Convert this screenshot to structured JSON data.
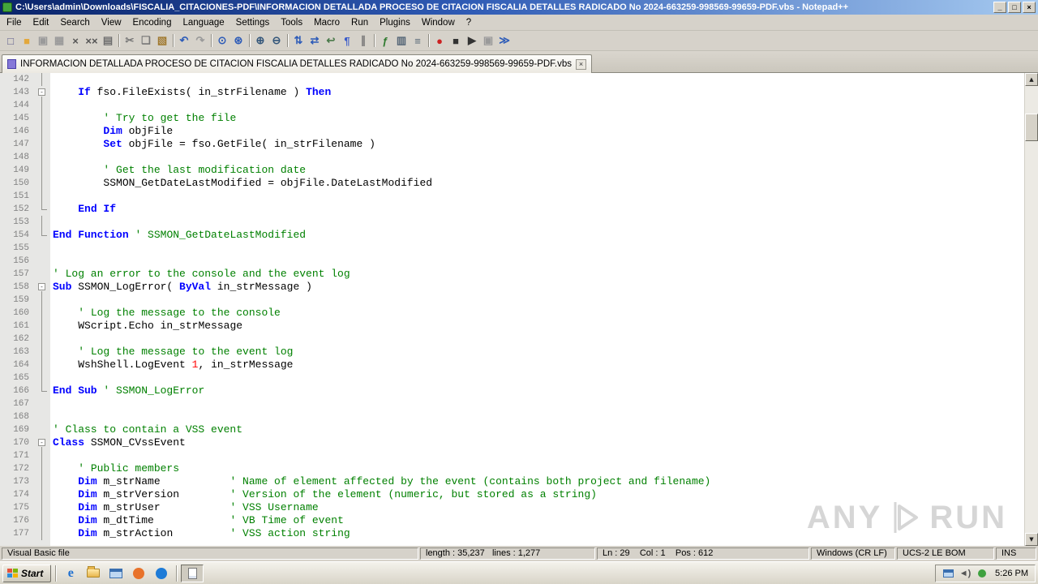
{
  "window": {
    "title": "C:\\Users\\admin\\Downloads\\FISCALIA_CITACIONES-PDF\\INFORMACION DETALLADA PROCESO DE CITACION FISCALIA DETALLES RADICADO No 2024-663259-998569-99659-PDF.vbs - Notepad++",
    "controls": {
      "minimize": "_",
      "maximize": "□",
      "close": "×"
    }
  },
  "colors": {
    "titlebar_left": "#0A246A",
    "titlebar_right": "#A6CAF0",
    "keyword": "#0000FF",
    "comment": "#008000",
    "number": "#FF0000",
    "line_number": "#808080"
  },
  "menu": {
    "items": [
      {
        "label": "File",
        "name": "file"
      },
      {
        "label": "Edit",
        "name": "edit"
      },
      {
        "label": "Search",
        "name": "search"
      },
      {
        "label": "View",
        "name": "view"
      },
      {
        "label": "Encoding",
        "name": "encoding"
      },
      {
        "label": "Language",
        "name": "language"
      },
      {
        "label": "Settings",
        "name": "settings"
      },
      {
        "label": "Tools",
        "name": "tools"
      },
      {
        "label": "Macro",
        "name": "macro"
      },
      {
        "label": "Run",
        "name": "run"
      },
      {
        "label": "Plugins",
        "name": "plugins"
      },
      {
        "label": "Window",
        "name": "window"
      },
      {
        "label": "?",
        "name": "help"
      }
    ]
  },
  "toolbar": {
    "items": [
      {
        "name": "new-file",
        "glyph": "□",
        "color": "#5A5A8C"
      },
      {
        "name": "open-file",
        "glyph": "■",
        "color": "#E3A83C"
      },
      {
        "name": "save-file",
        "glyph": "▣",
        "color": "#9A9A9A"
      },
      {
        "name": "save-all",
        "glyph": "▦",
        "color": "#9A9A9A"
      },
      {
        "name": "close-file",
        "glyph": "×",
        "color": "#555555"
      },
      {
        "name": "close-all",
        "glyph": "××",
        "color": "#555555"
      },
      {
        "name": "print",
        "glyph": "▤",
        "color": "#6E6E6E"
      },
      {
        "sep": true
      },
      {
        "name": "cut",
        "glyph": "✂",
        "color": "#777777"
      },
      {
        "name": "copy",
        "glyph": "❏",
        "color": "#777777"
      },
      {
        "name": "paste",
        "glyph": "▧",
        "color": "#A0792F"
      },
      {
        "sep": true
      },
      {
        "name": "undo",
        "glyph": "↶",
        "color": "#2E5CB8"
      },
      {
        "name": "redo",
        "glyph": "↷",
        "color": "#9A9A9A"
      },
      {
        "sep": true
      },
      {
        "name": "find",
        "glyph": "⊙",
        "color": "#2E5CB8"
      },
      {
        "name": "replace",
        "glyph": "⊛",
        "color": "#2E5CB8"
      },
      {
        "sep": true
      },
      {
        "name": "zoom-in",
        "glyph": "⊕",
        "color": "#33567A"
      },
      {
        "name": "zoom-out",
        "glyph": "⊖",
        "color": "#33567A"
      },
      {
        "sep": true
      },
      {
        "name": "sync-vertical-scroll",
        "glyph": "⇅",
        "color": "#2E5CB8"
      },
      {
        "name": "sync-horizontal-scroll",
        "glyph": "⇄",
        "color": "#2E5CB8"
      },
      {
        "name": "word-wrap",
        "glyph": "↩",
        "color": "#4A7A4A"
      },
      {
        "name": "show-all-characters",
        "glyph": "¶",
        "color": "#3A5ACA"
      },
      {
        "name": "indent-guide",
        "glyph": "∥",
        "color": "#777777"
      },
      {
        "sep": true
      },
      {
        "name": "function-list",
        "glyph": "ƒ",
        "color": "#2E7A2E"
      },
      {
        "name": "document-map",
        "glyph": "▥",
        "color": "#556677"
      },
      {
        "name": "document-list",
        "glyph": "≡",
        "color": "#556677"
      },
      {
        "sep": true
      },
      {
        "name": "record-macro",
        "glyph": "●",
        "color": "#CC2222"
      },
      {
        "name": "stop-macro",
        "glyph": "■",
        "color": "#333333"
      },
      {
        "name": "play-macro",
        "glyph": "▶",
        "color": "#333333"
      },
      {
        "name": "save-macro",
        "glyph": "▣",
        "color": "#9A9A9A"
      },
      {
        "name": "run-macro-multiple",
        "glyph": "≫",
        "color": "#2E5CB8"
      }
    ]
  },
  "tab": {
    "label": "INFORMACION DETALLADA PROCESO DE CITACION FISCALIA DETALLES RADICADO No 2024-663259-998569-99659-PDF.vbs",
    "close_glyph": "×"
  },
  "editor": {
    "scroll_up": "▲",
    "scroll_down": "▼",
    "fold_glyph": "-",
    "lines": [
      {
        "n": 142,
        "f": "line",
        "s": []
      },
      {
        "n": 143,
        "f": "box",
        "s": [
          [
            "t",
            "    "
          ],
          [
            "k",
            "If"
          ],
          [
            "t",
            " fso.FileExists( in_strFilename ) "
          ],
          [
            "k",
            "Then"
          ]
        ]
      },
      {
        "n": 144,
        "f": "line",
        "s": []
      },
      {
        "n": 145,
        "f": "line",
        "s": [
          [
            "t",
            "        "
          ],
          [
            "c",
            "' Try to get the file"
          ]
        ]
      },
      {
        "n": 146,
        "f": "line",
        "s": [
          [
            "t",
            "        "
          ],
          [
            "k",
            "Dim"
          ],
          [
            "t",
            " objFile"
          ]
        ]
      },
      {
        "n": 147,
        "f": "line",
        "s": [
          [
            "t",
            "        "
          ],
          [
            "k",
            "Set"
          ],
          [
            "t",
            " objFile = fso.GetFile( in_strFilename )"
          ]
        ]
      },
      {
        "n": 148,
        "f": "line",
        "s": []
      },
      {
        "n": 149,
        "f": "line",
        "s": [
          [
            "t",
            "        "
          ],
          [
            "c",
            "' Get the last modification date"
          ]
        ]
      },
      {
        "n": 150,
        "f": "line",
        "s": [
          [
            "t",
            "        "
          ],
          [
            "t",
            "SSMON_GetDateLastModified = objFile.DateLastModified"
          ]
        ]
      },
      {
        "n": 151,
        "f": "line",
        "s": []
      },
      {
        "n": 152,
        "f": "tail",
        "s": [
          [
            "t",
            "    "
          ],
          [
            "k",
            "End If"
          ]
        ]
      },
      {
        "n": 153,
        "f": "line",
        "s": []
      },
      {
        "n": 154,
        "f": "tail",
        "s": [
          [
            "k",
            "End Function"
          ],
          [
            "t",
            " "
          ],
          [
            "c",
            "' SSMON_GetDateLastModified"
          ]
        ]
      },
      {
        "n": 155,
        "s": []
      },
      {
        "n": 156,
        "s": []
      },
      {
        "n": 157,
        "s": [
          [
            "c",
            "' Log an error to the console and the event log"
          ]
        ]
      },
      {
        "n": 158,
        "f": "box",
        "s": [
          [
            "k",
            "Sub"
          ],
          [
            "t",
            " SSMON_LogError( "
          ],
          [
            "k",
            "ByVal"
          ],
          [
            "t",
            " in_strMessage )"
          ]
        ]
      },
      {
        "n": 159,
        "f": "line",
        "s": []
      },
      {
        "n": 160,
        "f": "line",
        "s": [
          [
            "t",
            "    "
          ],
          [
            "c",
            "' Log the message to the console"
          ]
        ]
      },
      {
        "n": 161,
        "f": "line",
        "s": [
          [
            "t",
            "    "
          ],
          [
            "t",
            "WScript.Echo in_strMessage"
          ]
        ]
      },
      {
        "n": 162,
        "f": "line",
        "s": []
      },
      {
        "n": 163,
        "f": "line",
        "s": [
          [
            "t",
            "    "
          ],
          [
            "c",
            "' Log the message to the event log"
          ]
        ]
      },
      {
        "n": 164,
        "f": "line",
        "s": [
          [
            "t",
            "    "
          ],
          [
            "t",
            "WshShell.LogEvent "
          ],
          [
            "n",
            "1"
          ],
          [
            "t",
            ", in_strMessage"
          ]
        ]
      },
      {
        "n": 165,
        "f": "line",
        "s": []
      },
      {
        "n": 166,
        "f": "tail",
        "s": [
          [
            "k",
            "End Sub"
          ],
          [
            "t",
            " "
          ],
          [
            "c",
            "' SSMON_LogError"
          ]
        ]
      },
      {
        "n": 167,
        "s": []
      },
      {
        "n": 168,
        "s": []
      },
      {
        "n": 169,
        "s": [
          [
            "c",
            "' Class to contain a VSS event"
          ]
        ]
      },
      {
        "n": 170,
        "f": "box",
        "s": [
          [
            "k",
            "Class"
          ],
          [
            "t",
            " SSMON_CVssEvent"
          ]
        ]
      },
      {
        "n": 171,
        "f": "line",
        "s": []
      },
      {
        "n": 172,
        "f": "line",
        "s": [
          [
            "t",
            "    "
          ],
          [
            "c",
            "' Public members"
          ]
        ]
      },
      {
        "n": 173,
        "f": "line",
        "s": [
          [
            "t",
            "    "
          ],
          [
            "k",
            "Dim"
          ],
          [
            "t",
            " m_strName           "
          ],
          [
            "c",
            "' Name of element affected by the event (contains both project and filename)"
          ]
        ]
      },
      {
        "n": 174,
        "f": "line",
        "s": [
          [
            "t",
            "    "
          ],
          [
            "k",
            "Dim"
          ],
          [
            "t",
            " m_strVersion        "
          ],
          [
            "c",
            "' Version of the element (numeric, but stored as a string)"
          ]
        ]
      },
      {
        "n": 175,
        "f": "line",
        "s": [
          [
            "t",
            "    "
          ],
          [
            "k",
            "Dim"
          ],
          [
            "t",
            " m_strUser           "
          ],
          [
            "c",
            "' VSS Username"
          ]
        ]
      },
      {
        "n": 176,
        "f": "line",
        "s": [
          [
            "t",
            "    "
          ],
          [
            "k",
            "Dim"
          ],
          [
            "t",
            " m_dtTime            "
          ],
          [
            "c",
            "' VB Time of event"
          ]
        ]
      },
      {
        "n": 177,
        "f": "line",
        "s": [
          [
            "t",
            "    "
          ],
          [
            "k",
            "Dim"
          ],
          [
            "t",
            " m_strAction         "
          ],
          [
            "c",
            "' VSS action string"
          ]
        ]
      }
    ]
  },
  "watermark": {
    "left": "ANY",
    "right": "RUN"
  },
  "statusbar": {
    "doc_type": "Visual Basic file",
    "length_lines": "length : 35,237   lines : 1,277",
    "cursor": "Ln : 29    Col : 1    Pos : 612",
    "eol": "Windows (CR LF)",
    "encoding": "UCS-2 LE BOM",
    "typing_mode": "INS"
  },
  "taskbar": {
    "start_label": "Start",
    "clock": "5:26 PM",
    "quicklaunch": [
      {
        "name": "internet-explorer-icon",
        "kind": "glyph",
        "glyph": "e",
        "color": "#1F6FD0"
      },
      {
        "name": "folder-icon",
        "kind": "folder"
      },
      {
        "name": "display-window-icon",
        "kind": "window"
      },
      {
        "name": "orange-browser-icon",
        "kind": "circle",
        "color": "#E8722A"
      },
      {
        "name": "blue-browser-icon",
        "kind": "circle",
        "color": "#1E7BD7"
      }
    ],
    "running": [
      {
        "name": "notepadpp-taskbar-button",
        "kind": "page"
      }
    ],
    "tray": [
      {
        "name": "network-icon",
        "kind": "window"
      },
      {
        "name": "volume-icon",
        "kind": "glyph",
        "glyph": "◄)",
        "color": "#555555"
      },
      {
        "name": "security-icon",
        "kind": "circle",
        "color": "#3FA13F"
      }
    ]
  }
}
